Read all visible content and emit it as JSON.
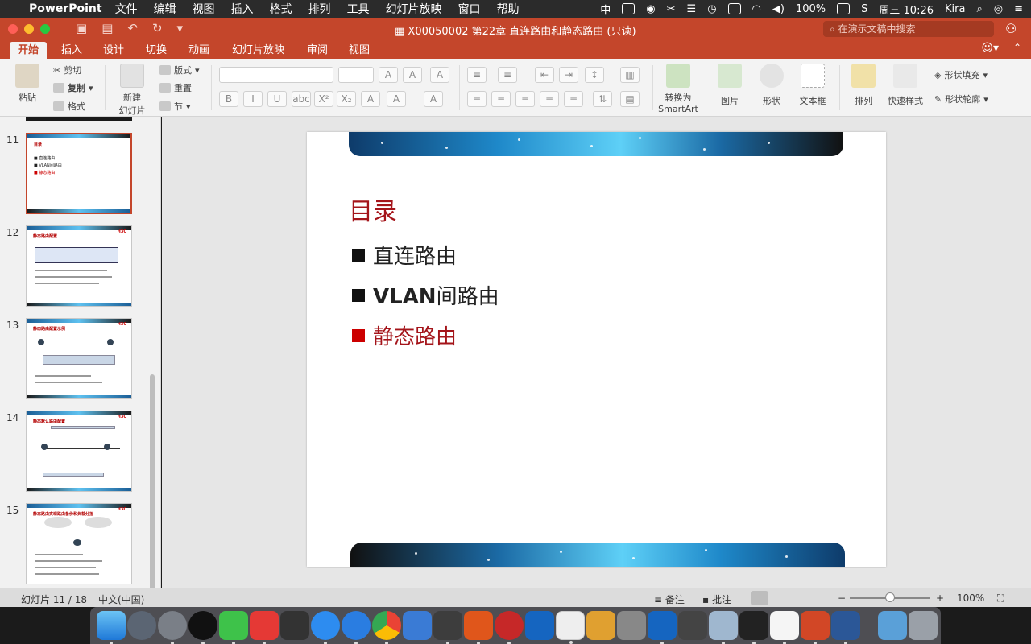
{
  "menubar": {
    "app_name": "PowerPoint",
    "menus": [
      "文件",
      "编辑",
      "视图",
      "插入",
      "格式",
      "排列",
      "工具",
      "幻灯片放映",
      "窗口",
      "帮助"
    ],
    "input_method": "中",
    "battery": "100%",
    "clock": "周三 10:26",
    "user": "Kira"
  },
  "window": {
    "document_title": "X00050002 第22章 直连路由和静态路由 (只读)",
    "search_placeholder": "在演示文稿中搜索"
  },
  "ribbon": {
    "tabs": [
      "开始",
      "插入",
      "设计",
      "切换",
      "动画",
      "幻灯片放映",
      "审阅",
      "视图"
    ],
    "active_tab": "开始",
    "paste": "粘贴",
    "cut": "剪切",
    "copy": "复制",
    "format": "格式",
    "new_slide_line1": "新建",
    "new_slide_line2": "幻灯片",
    "layout": "版式",
    "reset": "重置",
    "section": "节",
    "convert_smartart_line1": "转换为",
    "convert_smartart_line2": "SmartArt",
    "picture": "图片",
    "shape": "形状",
    "textbox": "文本框",
    "arrange": "排列",
    "quick_styles": "快速样式",
    "shape_fill": "形状填充",
    "shape_outline": "形状轮廓"
  },
  "thumbnails": [
    {
      "number": "11",
      "title": "目录",
      "selected": true,
      "items": [
        "■ 直连路由",
        "■ VLAN间路由",
        "■ 静态路由"
      ]
    },
    {
      "number": "12",
      "title": "静态路由配置",
      "selected": false
    },
    {
      "number": "13",
      "title": "静态路由配置示例",
      "selected": false
    },
    {
      "number": "14",
      "title": "静态默认路由配置",
      "selected": false
    },
    {
      "number": "15",
      "title": "静态路由实现路由备份和负载分担",
      "selected": false
    }
  ],
  "thumb_logo": "H3C",
  "slide": {
    "title": "目录",
    "bullets": [
      {
        "prefix": "",
        "text": "直连路由",
        "active": false
      },
      {
        "prefix": "VLAN",
        "text": "间路由",
        "active": false
      },
      {
        "prefix": "",
        "text": "静态路由",
        "active": true
      }
    ]
  },
  "statusbar": {
    "slide_counter": "幻灯片 11 / 18",
    "language": "中文(中国)",
    "notes": "备注",
    "comments": "批注",
    "zoom": "100%",
    "zoom_level_percent": 100
  },
  "colors": {
    "ribbon_accent": "#c4462b",
    "slide_title": "#a4141a",
    "bullet_active": "#cc0000"
  },
  "dock_apps": [
    "finder-icon",
    "launchpad-icon",
    "system-preferences-icon",
    "qq-icon",
    "wechat-icon",
    "app-g-icon",
    "video-icon",
    "safari-icon",
    "qq-browser-icon",
    "chrome-icon",
    "baidu-netdisk-icon",
    "sublime-icon",
    "vim-icon",
    "pycharm-icon",
    "xcode-icon",
    "vscode-icon",
    "keka-icon",
    "parallels-icon",
    "vm-icon",
    "flash-icon",
    "preview-icon",
    "terminal-icon",
    "wps-icon",
    "powerpoint-icon",
    "word-icon",
    "downloads-icon",
    "trash-icon"
  ]
}
